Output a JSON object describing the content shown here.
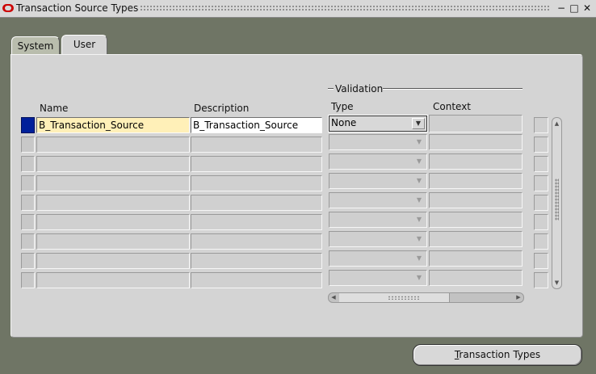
{
  "window": {
    "title": "Transaction Source Types",
    "controls": [
      "minimize-icon",
      "maximize-icon",
      "close-icon"
    ]
  },
  "tabs": [
    {
      "label": "System",
      "active": false
    },
    {
      "label": "User",
      "active": true
    }
  ],
  "group": {
    "validation_label": "Validation"
  },
  "columns": {
    "name": "Name",
    "description": "Description",
    "type": "Type",
    "context": "Context"
  },
  "rows": [
    {
      "name": "B_Transaction_Source",
      "description": "B_Transaction_Source",
      "type": "None",
      "context": ""
    },
    {
      "name": "",
      "description": "",
      "type": "",
      "context": ""
    },
    {
      "name": "",
      "description": "",
      "type": "",
      "context": ""
    },
    {
      "name": "",
      "description": "",
      "type": "",
      "context": ""
    },
    {
      "name": "",
      "description": "",
      "type": "",
      "context": ""
    },
    {
      "name": "",
      "description": "",
      "type": "",
      "context": ""
    },
    {
      "name": "",
      "description": "",
      "type": "",
      "context": ""
    },
    {
      "name": "",
      "description": "",
      "type": "",
      "context": ""
    },
    {
      "name": "",
      "description": "",
      "type": "",
      "context": ""
    }
  ],
  "buttons": {
    "transaction_types": {
      "prefix": "",
      "mnemonic": "T",
      "rest": "ransaction Types"
    }
  },
  "colors": {
    "background": "#6f7565",
    "panel": "#d4d4d4",
    "required_field": "#fff0b8",
    "record_indicator": "#00209a"
  }
}
